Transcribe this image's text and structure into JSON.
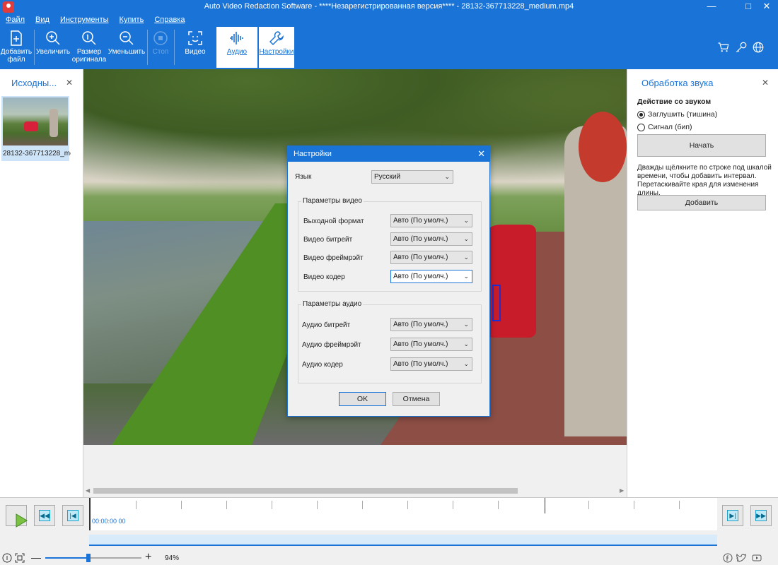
{
  "window": {
    "title": "Auto Video Redaction Software - ****Незарегистрированная версия**** - 28132-367713228_medium.mp4"
  },
  "menu": [
    "Файл",
    "Вид",
    "Инструменты",
    "Купить",
    "Справка"
  ],
  "toolbar": {
    "add_file": "Добавить файл",
    "zoom_in": "Увеличить",
    "original_size": "Размер оригинала",
    "zoom_out": "Уменьшить",
    "stop": "Стоп",
    "video": "Видео",
    "audio": "Аудио",
    "settings": "Настройки"
  },
  "left_panel": {
    "title": "Исходны...",
    "file_label": "28132-367713228_me..."
  },
  "right_panel": {
    "title": "Обработка звука",
    "action_label": "Действие со звуком",
    "option_mute": "Заглушить (тишина)",
    "option_beep": "Сигнал (бип)",
    "selected_option": "mute",
    "start_button": "Начать",
    "hint": "Дважды щёлкните по строке под шкалой времени, чтобы добавить интервал. Перетаскивайте края для изменения длины.",
    "add_button": "Добавить"
  },
  "dialog": {
    "title": "Настройки",
    "language_label": "Язык",
    "language_value": "Русский",
    "video_group": "Параметры видео",
    "output_format_label": "Выходной формат",
    "output_format_value": "Авто (По умолч.)",
    "video_bitrate_label": "Видео битрейт",
    "video_bitrate_value": "Авто (По умолч.)",
    "video_framerate_label": "Видео фреймрэйт",
    "video_framerate_value": "Авто (По умолч.)",
    "video_codec_label": "Видео кодер",
    "video_codec_value": "Авто (По умолч.)",
    "audio_group": "Параметры аудио",
    "audio_bitrate_label": "Аудио битрейт",
    "audio_bitrate_value": "Авто (По умолч.)",
    "audio_framerate_label": "Аудио фреймрэйт",
    "audio_framerate_value": "Авто (По умолч.)",
    "audio_codec_label": "Аудио кодер",
    "audio_codec_value": "Авто (По умолч.)",
    "ok": "OK",
    "cancel": "Отмена"
  },
  "timeline": {
    "time": "00:00:00 00"
  },
  "status": {
    "zoom": "94%",
    "zoom_level": 0.45
  },
  "colors": {
    "accent": "#1a73d6"
  }
}
